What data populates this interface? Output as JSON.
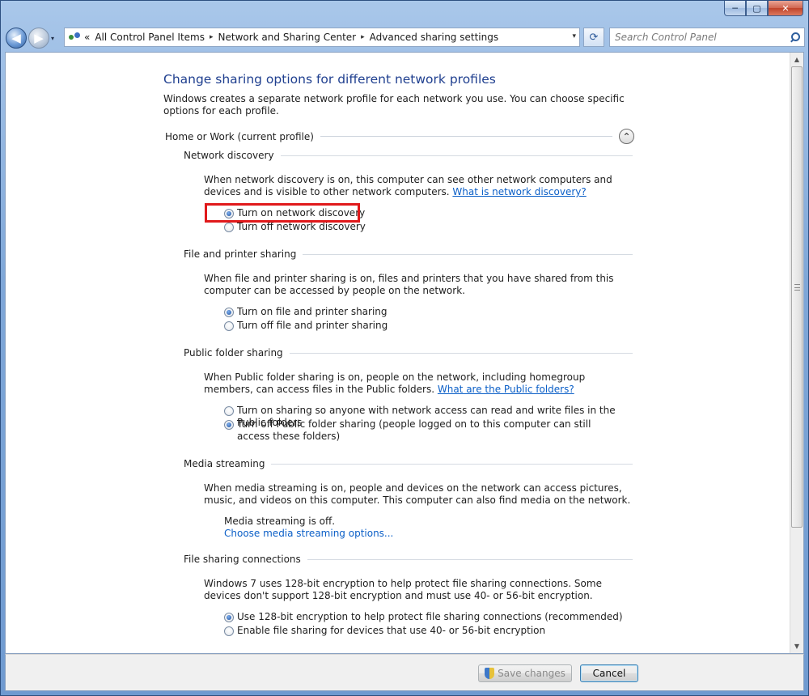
{
  "window": {
    "minimize_glyph": "─",
    "maximize_glyph": "▢",
    "close_glyph": "✕"
  },
  "navigation": {
    "back_glyph": "◀",
    "forward_glyph": "▶",
    "history_glyph": "▾",
    "breadcrumb_overflow": "«",
    "breadcrumbs": [
      "All Control Panel Items",
      "Network and Sharing Center",
      "Advanced sharing settings"
    ],
    "separator": "▸",
    "address_dropdown": "▾",
    "refresh_glyph": "⟳",
    "search_placeholder": "Search Control Panel"
  },
  "page": {
    "title": "Change sharing options for different network profiles",
    "intro": "Windows creates a separate network profile for each network you use. You can choose specific options for each profile.",
    "profile": {
      "label": "Home or Work (current profile)",
      "collapse_glyph": "⌃"
    }
  },
  "sections": {
    "network_discovery": {
      "title": "Network discovery",
      "description": "When network discovery is on, this computer can see other network computers and devices and is visible to other network computers.",
      "link": "What is network discovery?",
      "options": [
        "Turn on network discovery",
        "Turn off network discovery"
      ],
      "selected_index": 0
    },
    "file_printer": {
      "title": "File and printer sharing",
      "description": "When file and printer sharing is on, files and printers that you have shared from this computer can be accessed by people on the network.",
      "options": [
        "Turn on file and printer sharing",
        "Turn off file and printer sharing"
      ],
      "selected_index": 0
    },
    "public_folder": {
      "title": "Public folder sharing",
      "description": "When Public folder sharing is on, people on the network, including homegroup members, can access files in the Public folders.",
      "link": "What are the Public folders?",
      "options": [
        "Turn on sharing so anyone with network access can read and write files in the Public folders",
        "Turn off Public folder sharing (people logged on to this computer can still access these folders)"
      ],
      "selected_index": 1
    },
    "media_streaming": {
      "title": "Media streaming",
      "description": "When media streaming is on, people and devices on the network can access pictures, music, and videos on this computer. This computer can also find media on the network.",
      "status": "Media streaming is off.",
      "link": "Choose media streaming options..."
    },
    "file_sharing_connections": {
      "title": "File sharing connections",
      "description": "Windows 7 uses 128-bit encryption to help protect file sharing connections. Some devices don't support 128-bit encryption and must use 40- or 56-bit encryption.",
      "options": [
        "Use 128-bit encryption to help protect file sharing connections (recommended)",
        "Enable file sharing for devices that use 40- or 56-bit encryption"
      ],
      "selected_index": 0
    }
  },
  "footer": {
    "save_label": "Save changes",
    "cancel_label": "Cancel"
  },
  "colors": {
    "highlight_box": "#e0191b",
    "title_blue": "#1f3f8f",
    "link_blue": "#0b5fc7"
  }
}
